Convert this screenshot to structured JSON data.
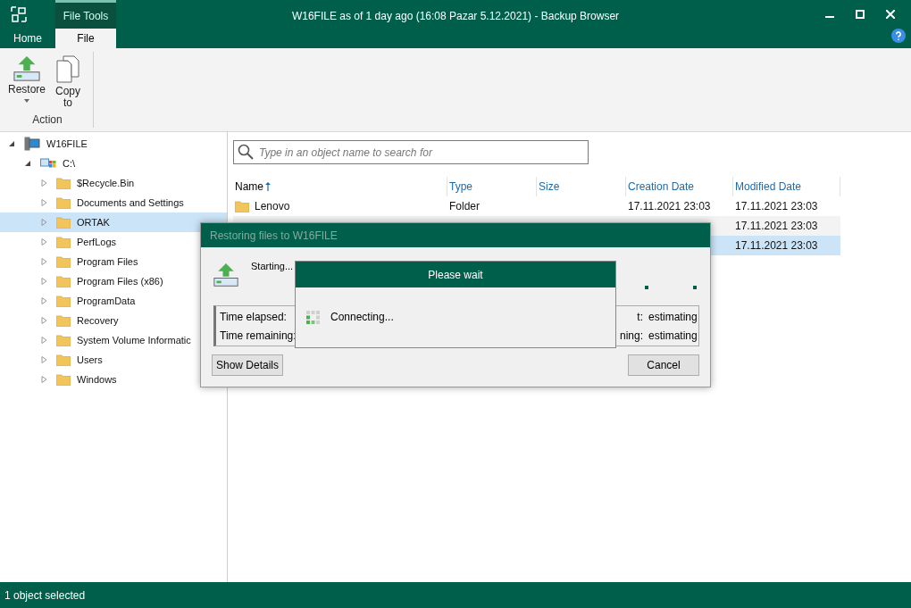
{
  "window": {
    "title": "W16FILE as of 1 day ago (16:08 Pazar 5.12.2021) - Backup Browser"
  },
  "context_tab": {
    "label": "File Tools"
  },
  "tabs": [
    {
      "label": "Home",
      "selected": false
    },
    {
      "label": "File",
      "selected": true
    }
  ],
  "ribbon": {
    "buttons": [
      {
        "label": "Restore",
        "kind": "restore",
        "dropdown": true
      },
      {
        "label": "Copy to",
        "kind": "copy",
        "dropdown": false
      }
    ],
    "group": "Action"
  },
  "tree": [
    {
      "label": "W16FILE",
      "kind": "server",
      "expanded": true,
      "selected": false,
      "children": [
        {
          "label": "C:\\",
          "kind": "drive",
          "expanded": true,
          "selected": false,
          "children": [
            {
              "label": "$Recycle.Bin",
              "kind": "folder",
              "expanded": false,
              "selected": false
            },
            {
              "label": "Documents and Settings",
              "kind": "folder",
              "expanded": false,
              "selected": false
            },
            {
              "label": "ORTAK",
              "kind": "folder",
              "expanded": false,
              "selected": true
            },
            {
              "label": "PerfLogs",
              "kind": "folder",
              "expanded": false,
              "selected": false
            },
            {
              "label": "Program Files",
              "kind": "folder",
              "expanded": false,
              "selected": false
            },
            {
              "label": "Program Files (x86)",
              "kind": "folder",
              "expanded": false,
              "selected": false
            },
            {
              "label": "ProgramData",
              "kind": "folder",
              "expanded": false,
              "selected": false
            },
            {
              "label": "Recovery",
              "kind": "folder",
              "expanded": false,
              "selected": false
            },
            {
              "label": "System Volume Informatic",
              "kind": "folder",
              "expanded": false,
              "selected": false
            },
            {
              "label": "Users",
              "kind": "folder",
              "expanded": false,
              "selected": false
            },
            {
              "label": "Windows",
              "kind": "folder",
              "expanded": false,
              "selected": false
            }
          ]
        }
      ]
    }
  ],
  "search": {
    "placeholder": "Type in an object name to search for"
  },
  "table": {
    "columns": [
      {
        "label": "Name",
        "sorted": true
      },
      {
        "label": "Type",
        "sorted": false
      },
      {
        "label": "Size",
        "sorted": false
      },
      {
        "label": "Creation Date",
        "sorted": false
      },
      {
        "label": "Modified Date",
        "sorted": false
      }
    ],
    "rows": [
      {
        "name": "Lenovo",
        "type": "Folder",
        "created": "17.11.2021 23:03",
        "modified": "17.11.2021 23:03",
        "selected": false
      },
      {
        "modified": "17.11.2021 23:03",
        "selected": false
      },
      {
        "modified": "17.11.2021 23:03",
        "selected": true
      }
    ]
  },
  "restore_dialog": {
    "title": "Restoring files to W16FILE",
    "status": "Starting...",
    "stats": [
      {
        "label": "Time elapsed:"
      },
      {
        "label": "t:",
        "value": "estimating"
      },
      {
        "label": "Time remaining:"
      },
      {
        "label": "ning:",
        "value": "estimating"
      }
    ],
    "buttons": [
      "Show Details",
      "Cancel"
    ]
  },
  "wait_dialog": {
    "title": "Please wait",
    "message": "Connecting..."
  },
  "status_bar": {
    "text": "1 object selected"
  }
}
